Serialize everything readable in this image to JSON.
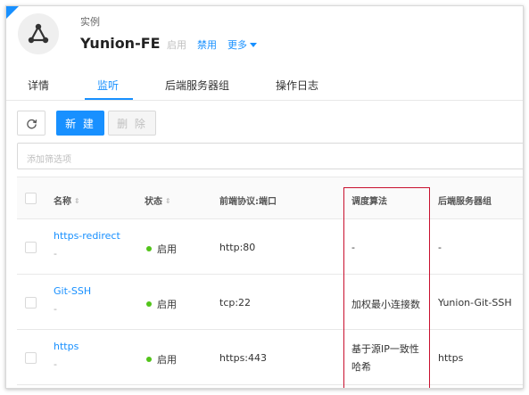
{
  "header": {
    "type_label": "实例",
    "name": "Yunion-FE",
    "actions": {
      "enable": "启用",
      "disable": "禁用",
      "more": "更多"
    }
  },
  "tabs": [
    {
      "label": "详情",
      "active": false
    },
    {
      "label": "监听",
      "active": true
    },
    {
      "label": "后端服务器组",
      "active": false
    },
    {
      "label": "操作日志",
      "active": false
    }
  ],
  "toolbar": {
    "new_label": "新 建",
    "delete_label": "删 除"
  },
  "filter": {
    "placeholder": "添加筛选项"
  },
  "table": {
    "columns": [
      "名称",
      "状态",
      "前端协议:端口",
      "调度算法",
      "后端服务器组"
    ],
    "rows": [
      {
        "name": "https-redirect",
        "sub": "-",
        "status": "启用",
        "protocol": "http:80",
        "algorithm": "-",
        "backend_group": "-"
      },
      {
        "name": "Git-SSH",
        "sub": "-",
        "status": "启用",
        "protocol": "tcp:22",
        "algorithm": "加权最小连接数",
        "backend_group": "Yunion-Git-SSH"
      },
      {
        "name": "https",
        "sub": "-",
        "status": "启用",
        "protocol": "https:443",
        "algorithm": "基于源IP一致性哈希",
        "backend_group": "https"
      }
    ]
  },
  "colors": {
    "accent": "#1890ff",
    "status_green": "#52c41a",
    "highlight": "#c8102e"
  }
}
